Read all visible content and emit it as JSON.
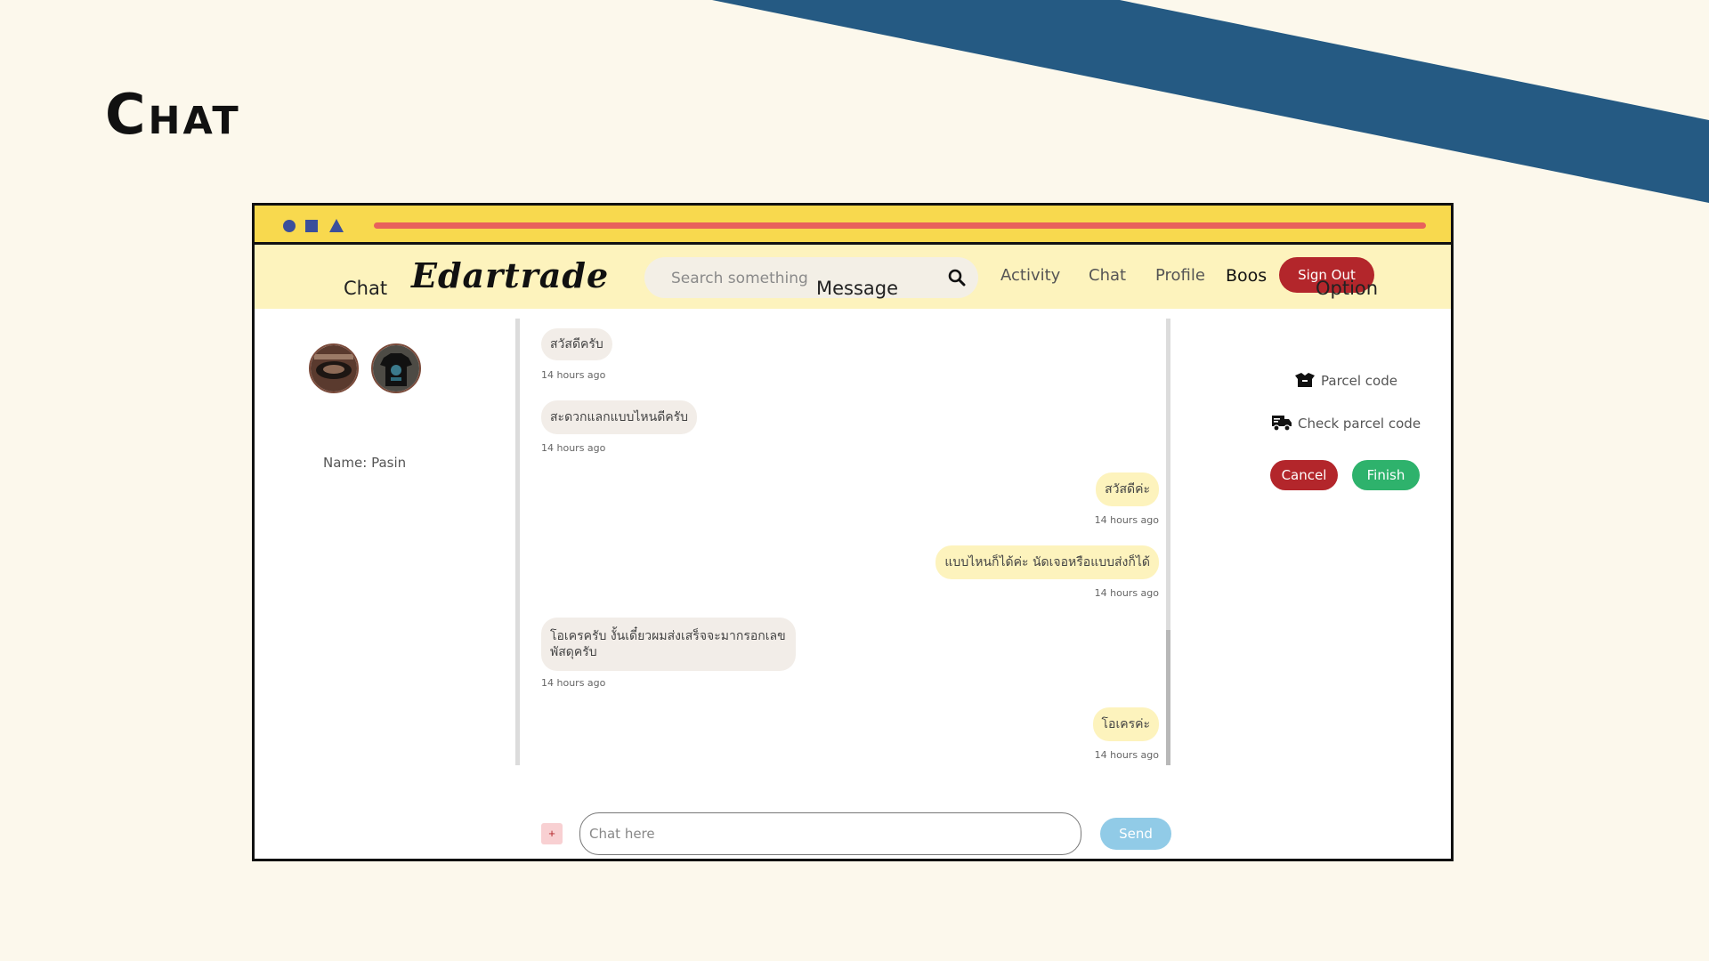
{
  "slide": {
    "title": "Chat"
  },
  "colors": {
    "stripe": "#255a83",
    "titlebar": "#f8d94e",
    "navbar": "#fdf3bd",
    "danger": "#b3262b",
    "success": "#2eb26c",
    "send": "#91cbe7"
  },
  "navbar": {
    "logo": "Edartrade",
    "search_placeholder": "Search something",
    "links": [
      "Activity",
      "Chat",
      "Profile"
    ],
    "username": "Boos",
    "signout": "Sign Out"
  },
  "columns": {
    "chat": "Chat",
    "message": "Message",
    "option": "Option"
  },
  "contact": {
    "name": "Name: Pasin"
  },
  "messages": [
    {
      "side": "in",
      "text": "สวัสดีครับ",
      "time": "14 hours ago"
    },
    {
      "side": "in",
      "text": "สะดวกแลกแบบไหนดีครับ",
      "time": "14 hours ago"
    },
    {
      "side": "out",
      "text": "สวัสดีค่ะ",
      "time": "14 hours ago"
    },
    {
      "side": "out",
      "text": "แบบไหนก็ได้ค่ะ นัดเจอหรือแบบส่งก็ได้",
      "time": "14 hours ago"
    },
    {
      "side": "in",
      "text": "โอเครครับ งั้นเดี๋ยวผมส่งเสร็จจะมากรอกเลขพัสดุครับ",
      "time": "14 hours ago"
    },
    {
      "side": "out",
      "text": "โอเครค่ะ",
      "time": "14 hours ago"
    }
  ],
  "options": {
    "parcel_code": "Parcel code",
    "check_parcel_code": "Check parcel code",
    "cancel": "Cancel",
    "finish": "Finish"
  },
  "composer": {
    "add": "+",
    "placeholder": "Chat here",
    "send": "Send"
  }
}
